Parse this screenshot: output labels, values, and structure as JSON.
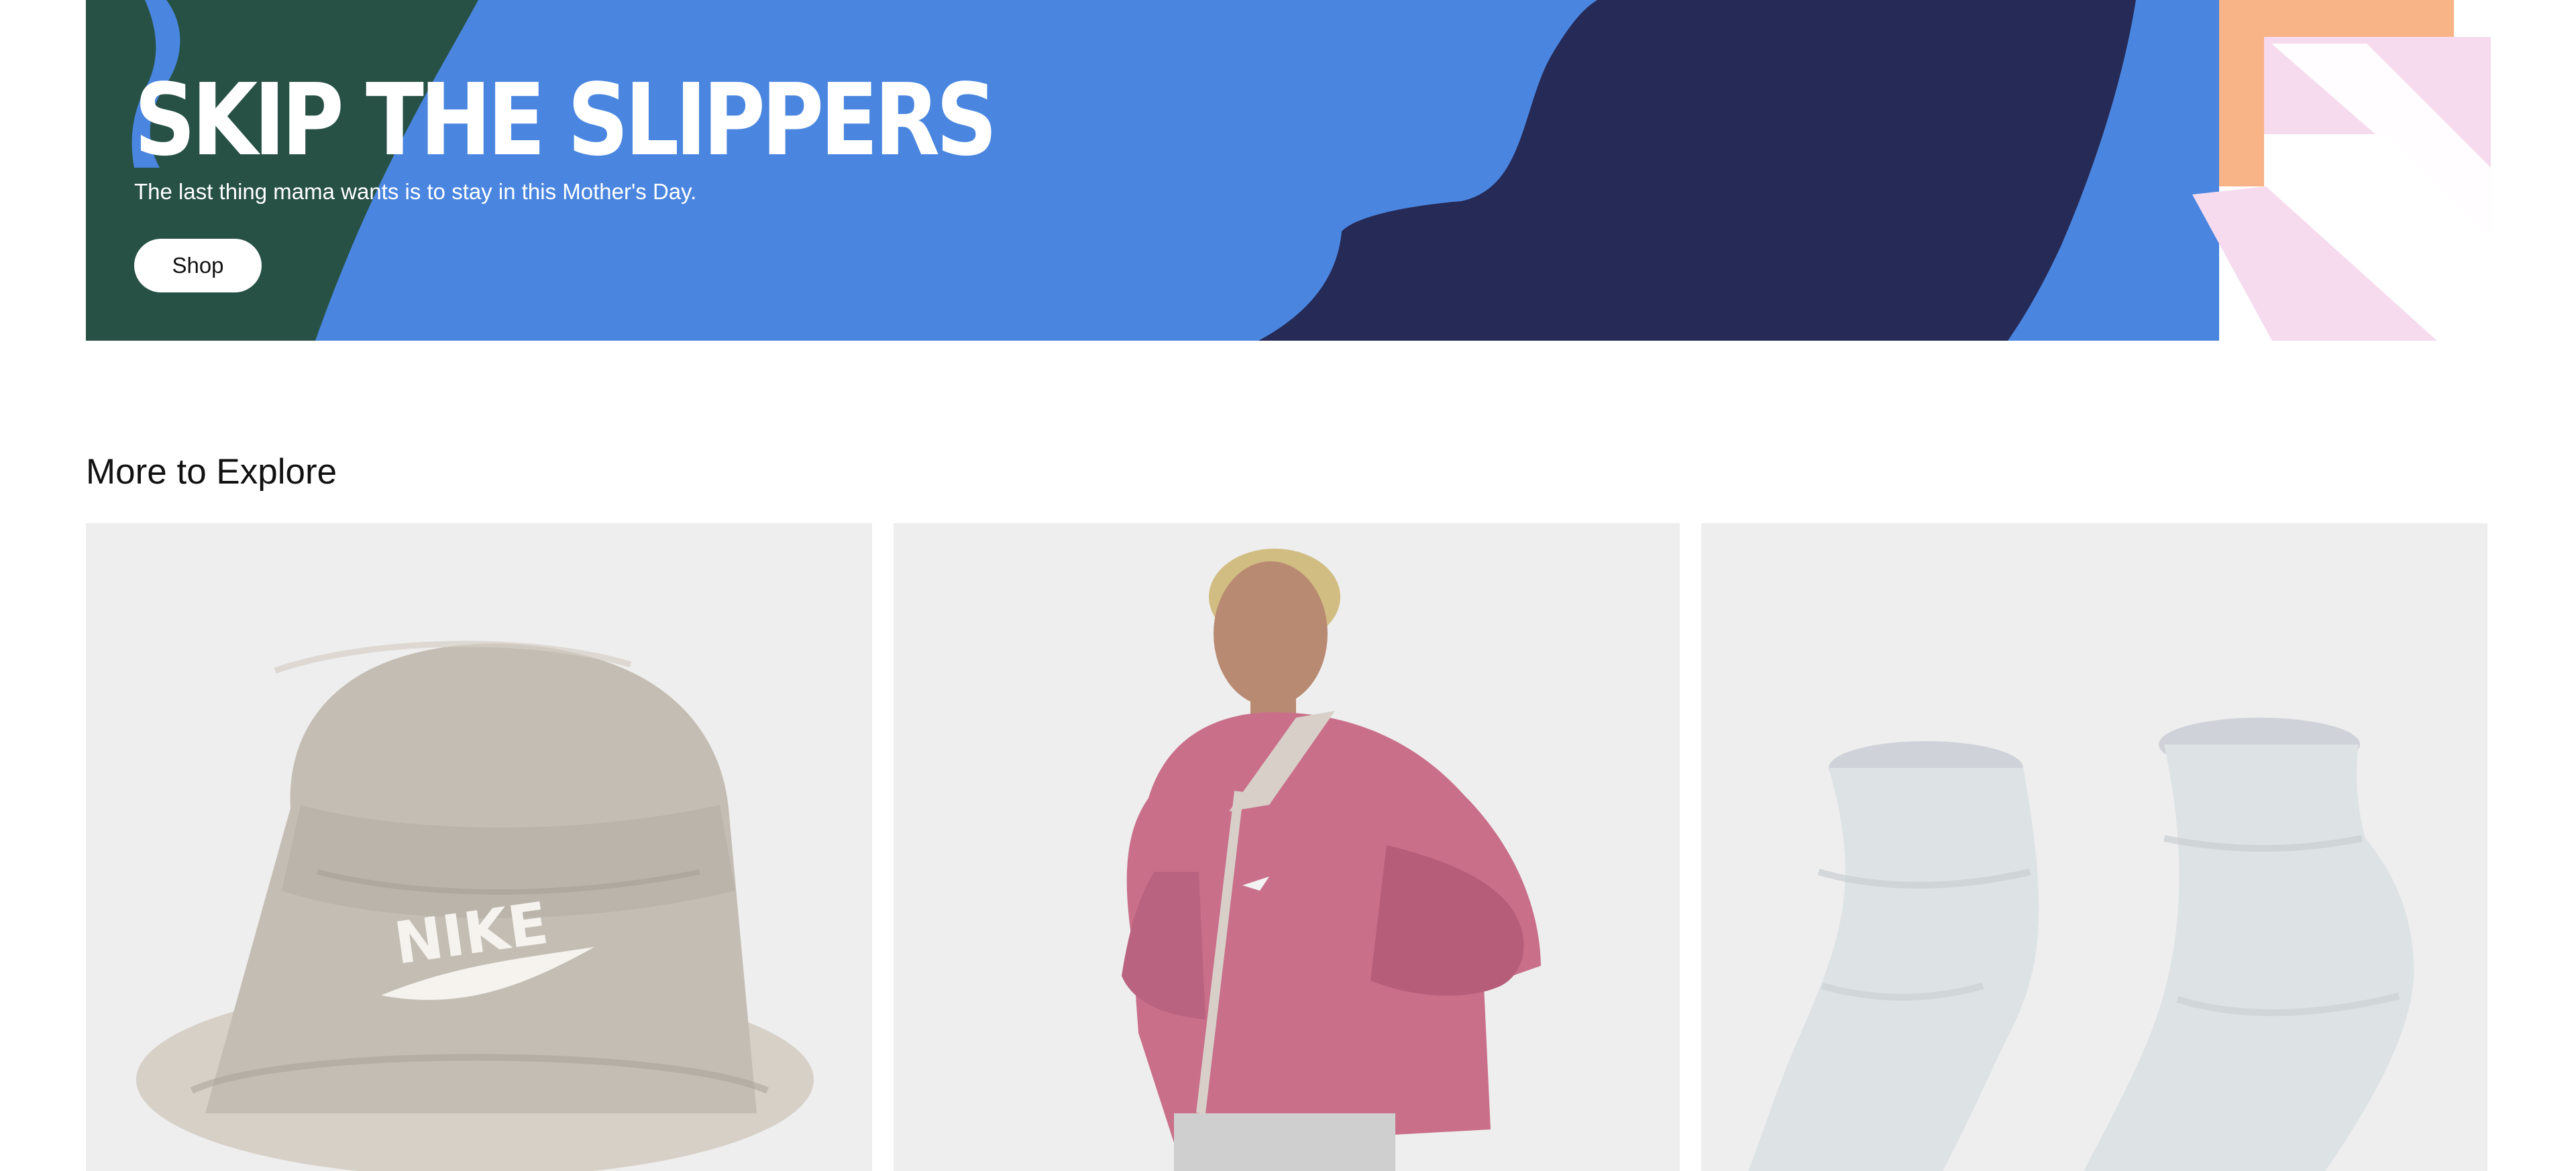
{
  "hero": {
    "title": "SKIP THE SLIPPERS",
    "subtitle": "The last thing mama wants is to stay in this Mother's Day.",
    "button_label": "Shop",
    "background_color": "#4a86e0"
  },
  "explore": {
    "title": "More to Explore",
    "tiles": [
      {
        "image": "bucket-hat-product-image",
        "logo_text": "NIKE"
      },
      {
        "image": "woman-pink-sweatshirt-image"
      },
      {
        "image": "white-crew-socks-image"
      }
    ]
  },
  "colors": {
    "hero_blue": "#4a86e0",
    "hero_navy": "#262a56",
    "hero_green": "#275145",
    "hero_orange": "#f8b487",
    "hero_pink": "#f6dbef",
    "tile_background": "#eeeeee",
    "text": "#111111"
  }
}
